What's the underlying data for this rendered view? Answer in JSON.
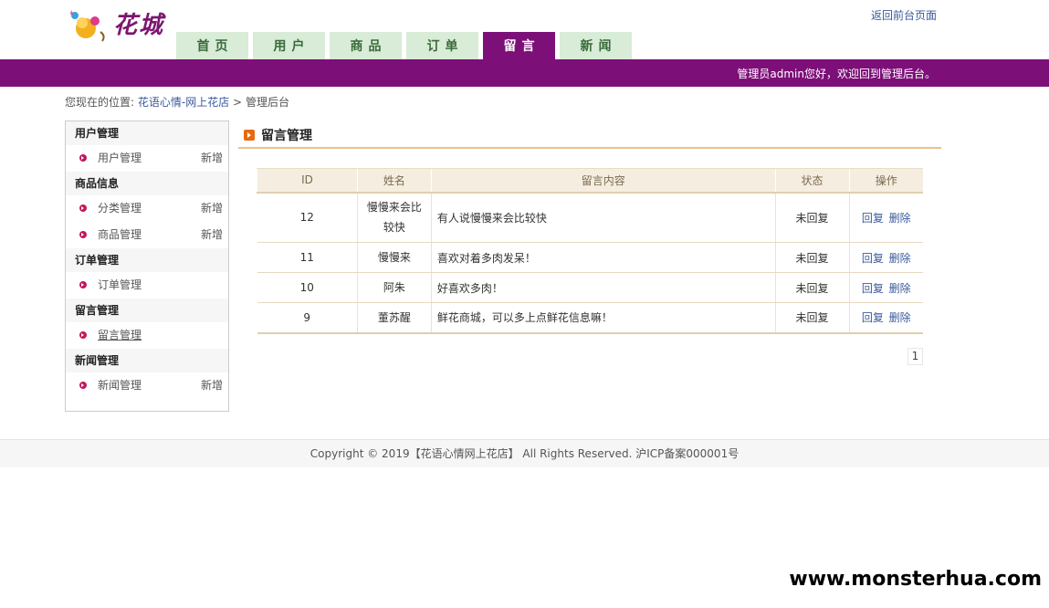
{
  "header": {
    "logo_text": "花城",
    "back_link": "返回前台页面",
    "welcome": "管理员admin您好，欢迎回到管理后台。"
  },
  "nav": {
    "tabs": [
      {
        "label": "首页"
      },
      {
        "label": "用户"
      },
      {
        "label": "商品"
      },
      {
        "label": "订单"
      },
      {
        "label": "留言"
      },
      {
        "label": "新闻"
      }
    ],
    "active_index": 4
  },
  "breadcrumb": {
    "prefix": "您现在的位置:",
    "site": "花语心情-网上花店",
    "separator": ">",
    "current": "管理后台"
  },
  "sidebar": {
    "groups": [
      {
        "title": "用户管理",
        "items": [
          {
            "label": "用户管理",
            "add": "新增"
          }
        ]
      },
      {
        "title": "商品信息",
        "items": [
          {
            "label": "分类管理",
            "add": "新增"
          },
          {
            "label": "商品管理",
            "add": "新增"
          }
        ]
      },
      {
        "title": "订单管理",
        "items": [
          {
            "label": "订单管理",
            "add": ""
          }
        ]
      },
      {
        "title": "留言管理",
        "items": [
          {
            "label": "留言管理",
            "add": ""
          }
        ]
      },
      {
        "title": "新闻管理",
        "items": [
          {
            "label": "新闻管理",
            "add": "新增"
          }
        ]
      }
    ]
  },
  "main": {
    "title": "留言管理",
    "table": {
      "headers": [
        "ID",
        "姓名",
        "留言内容",
        "状态",
        "操作"
      ],
      "rows": [
        {
          "id": "12",
          "name": "慢慢来会比较快",
          "content": "有人说慢慢来会比较快",
          "status": "未回复",
          "reply": "回复",
          "delete": "删除"
        },
        {
          "id": "11",
          "name": "慢慢来",
          "content": "喜欢对着多肉发呆！",
          "status": "未回复",
          "reply": "回复",
          "delete": "删除"
        },
        {
          "id": "10",
          "name": "阿朱",
          "content": "好喜欢多肉！",
          "status": "未回复",
          "reply": "回复",
          "delete": "删除"
        },
        {
          "id": "9",
          "name": "董苏醒",
          "content": "鲜花商城，可以多上点鲜花信息嘛！",
          "status": "未回复",
          "reply": "回复",
          "delete": "删除"
        }
      ]
    },
    "pager": {
      "page": "1"
    }
  },
  "footer": {
    "copyright": "Copyright © 2019【花语心情网上花店】 All Rights Reserved. 沪ICP备案000001号"
  },
  "watermark": "www.monsterhua.com",
  "colors": {
    "accent": "#7d0f78",
    "nav_tab": "#d8ecd8",
    "table_header": "#f5eee0",
    "link": "#3a5a9a",
    "title_rule": "#f0c090"
  }
}
